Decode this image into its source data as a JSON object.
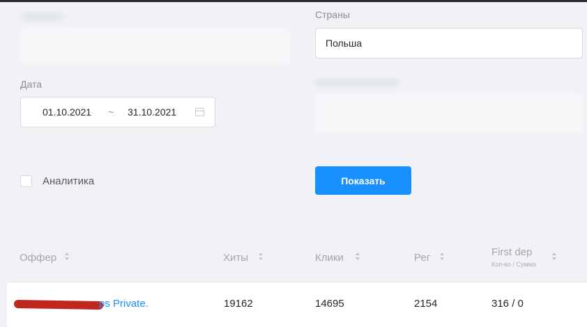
{
  "filters": {
    "countries_label": "Страны",
    "countries_value": "Польша",
    "date_label": "Дата",
    "date_from": "01.10.2021",
    "date_separator": "~",
    "date_to": "31.10.2021",
    "analytics_label": "Аналитика",
    "analytics_checked": false,
    "show_button": "Показать"
  },
  "table": {
    "columns": [
      {
        "label": "Оффер"
      },
      {
        "label": "Хиты"
      },
      {
        "label": "Клики"
      },
      {
        "label": "Рег"
      },
      {
        "label": "First dep",
        "sublabel": "Кол-во / Сумма"
      }
    ],
    "rows": [
      {
        "offer": "ps Private.",
        "hits": "19162",
        "clicks": "14695",
        "reg": "2154",
        "first_dep": "316 / 0"
      }
    ]
  },
  "colors": {
    "accent": "#1890ff",
    "background": "#f0f2f5",
    "redaction": "#c0281f"
  },
  "icons": {
    "calendar": "calendar-icon",
    "sort": "sort-icon"
  }
}
